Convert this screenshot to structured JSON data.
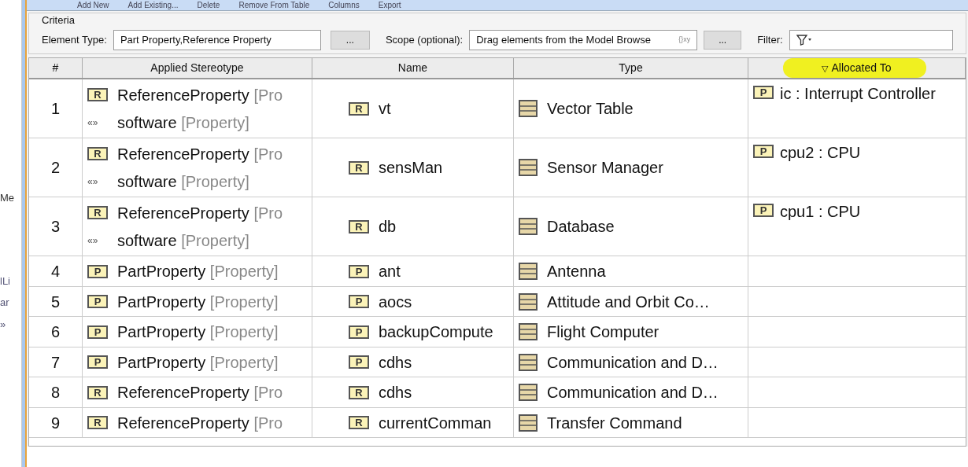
{
  "left_panel": {
    "fragments": [
      "Me",
      "lLi",
      "ar",
      "»"
    ]
  },
  "toolbar": {
    "items": [
      "Add New",
      "Add Existing...",
      "Delete",
      "Remove From Table",
      "Columns",
      "Export"
    ]
  },
  "criteria": {
    "title": "Criteria",
    "element_type_label": "Element Type:",
    "element_type_value": "Part Property,Reference Property",
    "browse_button": "...",
    "scope_label": "Scope (optional):",
    "scope_placeholder": "Drag elements from the Model Browse",
    "scope_hint": "{}xy",
    "scope_button": "...",
    "filter_label": "Filter:"
  },
  "table": {
    "columns": [
      {
        "label": "#",
        "highlighted": false
      },
      {
        "label": "Applied Stereotype",
        "highlighted": false
      },
      {
        "label": "Name",
        "highlighted": false
      },
      {
        "label": "Type",
        "highlighted": false
      },
      {
        "label": "Allocated To",
        "highlighted": true,
        "sort_mark": "▽"
      }
    ],
    "rows": [
      {
        "number": "1",
        "stereotypes": [
          {
            "kind": "badge",
            "badge": "R",
            "name": "ReferenceProperty",
            "meta": "[Pro"
          },
          {
            "kind": "guillemets",
            "badge": "«»",
            "name": "software",
            "meta": "[Property]"
          }
        ],
        "name_badge": "R",
        "name": "vt",
        "type": "Vector Table",
        "allocated": {
          "badge": "P",
          "text": "ic : Interrupt Controller"
        }
      },
      {
        "number": "2",
        "stereotypes": [
          {
            "kind": "badge",
            "badge": "R",
            "name": "ReferenceProperty",
            "meta": "[Pro"
          },
          {
            "kind": "guillemets",
            "badge": "«»",
            "name": "software",
            "meta": "[Property]"
          }
        ],
        "name_badge": "R",
        "name": "sensMan",
        "type": "Sensor Manager",
        "allocated": {
          "badge": "P",
          "text": "cpu2 : CPU"
        }
      },
      {
        "number": "3",
        "stereotypes": [
          {
            "kind": "badge",
            "badge": "R",
            "name": "ReferenceProperty",
            "meta": "[Pro"
          },
          {
            "kind": "guillemets",
            "badge": "«»",
            "name": "software",
            "meta": "[Property]"
          }
        ],
        "name_badge": "R",
        "name": "db",
        "type": "Database",
        "allocated": {
          "badge": "P",
          "text": "cpu1 : CPU"
        }
      },
      {
        "number": "4",
        "stereotypes": [
          {
            "kind": "badge",
            "badge": "P",
            "name": "PartProperty",
            "meta": "[Property]"
          }
        ],
        "name_badge": "P",
        "name": "ant",
        "type": "Antenna"
      },
      {
        "number": "5",
        "stereotypes": [
          {
            "kind": "badge",
            "badge": "P",
            "name": "PartProperty",
            "meta": "[Property]"
          }
        ],
        "name_badge": "P",
        "name": "aocs",
        "type": "Attitude and Orbit Co…"
      },
      {
        "number": "6",
        "stereotypes": [
          {
            "kind": "badge",
            "badge": "P",
            "name": "PartProperty",
            "meta": "[Property]"
          }
        ],
        "name_badge": "P",
        "name": "backupCompute",
        "type": "Flight Computer"
      },
      {
        "number": "7",
        "stereotypes": [
          {
            "kind": "badge",
            "badge": "P",
            "name": "PartProperty",
            "meta": "[Property]"
          }
        ],
        "name_badge": "P",
        "name": "cdhs",
        "type": "Communication and D…"
      },
      {
        "number": "8",
        "stereotypes": [
          {
            "kind": "badge",
            "badge": "R",
            "name": "ReferenceProperty",
            "meta": "[Pro"
          }
        ],
        "name_badge": "R",
        "name": "cdhs",
        "type": "Communication and D…"
      },
      {
        "number": "9",
        "stereotypes": [
          {
            "kind": "badge",
            "badge": "R",
            "name": "ReferenceProperty",
            "meta": "[Pro"
          }
        ],
        "name_badge": "R",
        "name": "currentComman",
        "type": "Transfer Command"
      }
    ]
  }
}
